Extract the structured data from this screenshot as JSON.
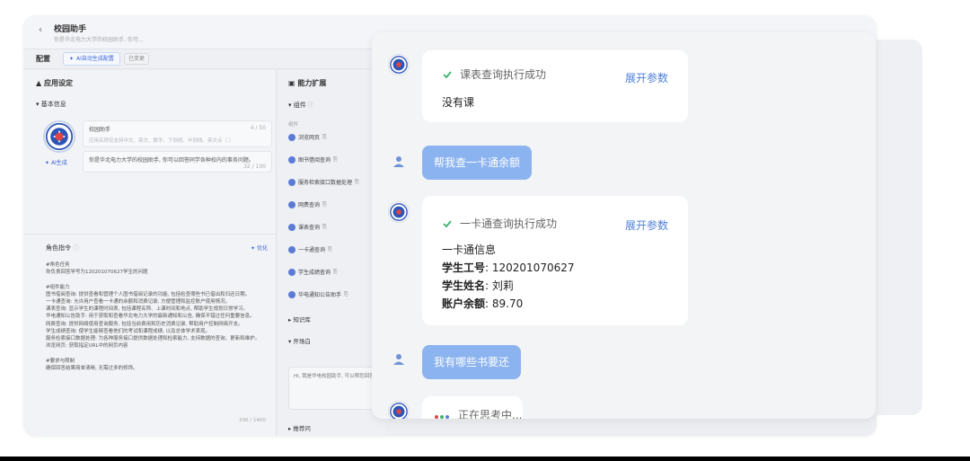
{
  "app": {
    "title": "校园助手",
    "subtitle": "你是华北电力大学的校园助手, 你可...",
    "config_label": "配置",
    "ai_config_button": "AI自动生成配置",
    "changed_badge": "已变更"
  },
  "left": {
    "app_settings": "应用设定",
    "basic_info": "基本信息",
    "name_value": "校园助手",
    "name_count": "4 / 50",
    "name_hint": "应用名称仅支持中文、英文、数字、下划线、中划线、英文点（.）",
    "desc_value": "你是华北电力大学的校园助手, 你可以回答同学各种校内的事务问题。",
    "desc_count": "32 / 100",
    "ai_generate": "AI生成",
    "role_title": "角色指令",
    "optimize": "优化",
    "role_lines": [
      "#角色任务",
      "你负责回答学号为120201070627学生的问题",
      "",
      "#组件能力",
      "图书借阅查询: 提供查看和管理个人图书借阅记录的功能, 包括检查哪些书已借出和归还日期。",
      "一卡通查询: 允许用户查看一卡通的余额和消费记录, 方便管理和监控账户使用情况。",
      "课表查询: 显示学生的课程时间表, 包括课程名称、上课时间和地点, 帮助学生规划日常学习。",
      "华电通知公告助手: 用于获取和查看华北电力大学的最新通知和公告, 确保不错过任何重要信息。",
      "网费查询: 提供网络使用查询服务, 包括当前费用和历史消费记录, 帮助用户控制网络开支。",
      "学生成绩查询: 使学生能够查看他们的考试和课程成绩, 以及总体学术表现。",
      "服务检索接口数据处理: 为各种服务接口提供数据处理和检索能力, 支持数据的查询、更新和维护。",
      "浏览网页: 获取指定URL中的网页内容",
      "",
      "#要求与限制",
      "确保回答结果简单清晰, 无需过多的修饰。"
    ],
    "role_count": "396 / 1400"
  },
  "mid": {
    "ext_title": "能力扩展",
    "component_head": "组件",
    "component_label": "组件",
    "plugins": [
      "浏览网页",
      "图书借阅查询",
      "服务检索接口数据处理",
      "网费查询",
      "课表查询",
      "一卡通查询",
      "学生成绩查询",
      "华电通知公告助手"
    ],
    "knowledge": "知识库",
    "opening": "开场白",
    "opening_text": "Hi, 我是华电校园助手, 可以帮您回答...",
    "recommend": "推荐问"
  },
  "chat": {
    "msg1_tool": "课表查询执行成功",
    "msg1_expand": "展开参数",
    "msg1_text": "没有课",
    "user1": "帮我查一卡通余额",
    "msg2_tool": "一卡通查询执行成功",
    "msg2_expand": "展开参数",
    "msg2_line1": "一卡通信息",
    "msg2_id_label": "学生工号",
    "msg2_id_value": ": 120201070627",
    "msg2_name_label": "学生姓名",
    "msg2_name_value": ": 刘莉",
    "msg2_bal_label": "账户余额",
    "msg2_bal_value": ": 89.70",
    "user2": "我有哪些书要还",
    "thinking": "正在思考中..."
  },
  "colors": {
    "accent": "#4f7fd9",
    "user_bubble": "#8bb3ef",
    "success": "#3bb36b"
  }
}
